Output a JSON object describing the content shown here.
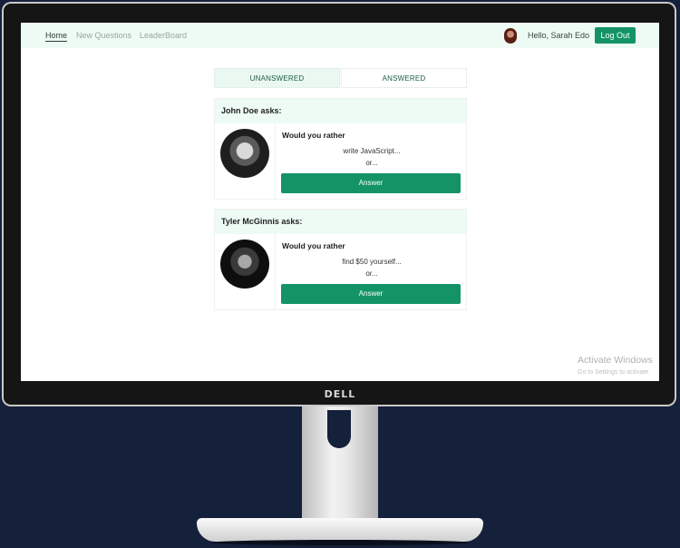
{
  "nav": {
    "links": [
      "Home",
      "New Questions",
      "LeaderBoard"
    ],
    "greeting": "Hello, Sarah Edo",
    "logout_label": "Log Out"
  },
  "tabs": {
    "unanswered": "UNANSWERED",
    "answered": "ANSWERED"
  },
  "questions": [
    {
      "header": "John Doe asks:",
      "prompt": "Would you rather",
      "option": "write JavaScript...",
      "or_text": "or...",
      "button": "Answer"
    },
    {
      "header": "Tyler McGinnis asks:",
      "prompt": "Would you rather",
      "option": "find $50 yourself...",
      "or_text": "or...",
      "button": "Answer"
    }
  ],
  "watermark": {
    "title": "Activate Windows",
    "subtitle": "Go to Settings to activate"
  },
  "monitor": {
    "brand": "DELL"
  },
  "colors": {
    "accent": "#149466",
    "navbar_bg": "#eefbf4",
    "page_bg": "#15203a"
  }
}
